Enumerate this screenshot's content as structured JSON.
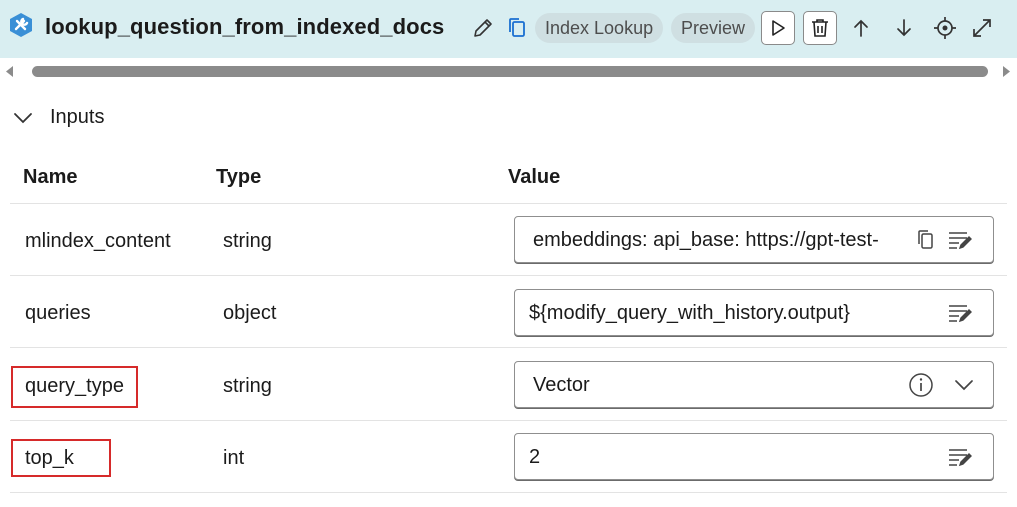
{
  "header": {
    "title": "lookup_question_from_indexed_docs",
    "badges": [
      "Index Lookup",
      "Preview"
    ],
    "icons": [
      "tool-icon",
      "edit-icon",
      "copy-icon",
      "run-icon",
      "delete-icon",
      "arrow-up-icon",
      "arrow-down-icon",
      "locate-icon",
      "expand-icon"
    ]
  },
  "section": {
    "label": "Inputs",
    "expanded": true
  },
  "table": {
    "columns": [
      "Name",
      "Type",
      "Value"
    ],
    "rows": [
      {
        "name": "mlindex_content",
        "type": "string",
        "value": "embeddings:  api_base: https://gpt-test-",
        "control": "textarea-with-copy"
      },
      {
        "name": "queries",
        "type": "object",
        "value": "${modify_query_with_history.output}",
        "control": "textarea"
      },
      {
        "name": "query_type",
        "type": "string",
        "value": "Vector",
        "control": "dropdown"
      },
      {
        "name": "top_k",
        "type": "int",
        "value": "2",
        "control": "textarea"
      }
    ],
    "highlighted_rows": [
      "query_type",
      "top_k"
    ]
  },
  "colors": {
    "header_bg": "#d9eef1",
    "highlight": "#d62a2a",
    "scrollbar": "#8b8b8b"
  }
}
